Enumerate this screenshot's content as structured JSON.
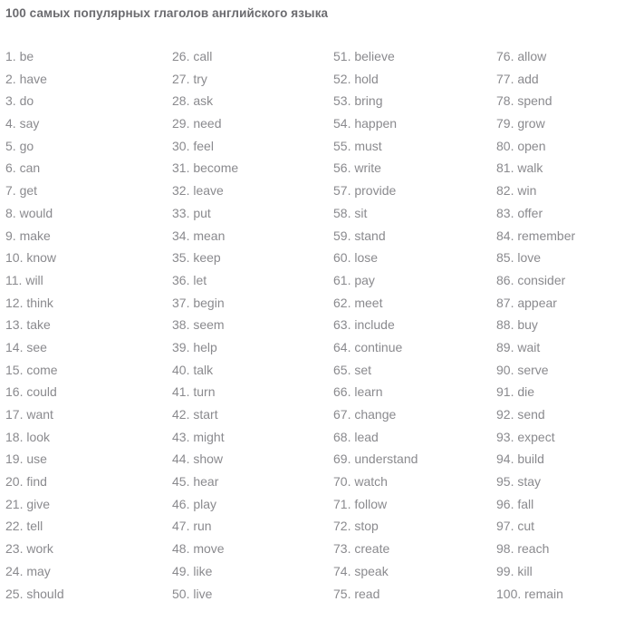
{
  "header": {
    "title": "100 самых популярных глаголов английского языка"
  },
  "colors": {
    "title_text": "#6b6b6f",
    "list_text": "#8a8a8e",
    "background": "#ffffff"
  },
  "columns": [
    {
      "name": "column-1",
      "items": [
        {
          "num": "1.",
          "word": "be"
        },
        {
          "num": "2.",
          "word": "have"
        },
        {
          "num": "3.",
          "word": "do"
        },
        {
          "num": "4.",
          "word": "say"
        },
        {
          "num": "5.",
          "word": "go"
        },
        {
          "num": "6.",
          "word": "can"
        },
        {
          "num": "7.",
          "word": "get"
        },
        {
          "num": "8.",
          "word": "would"
        },
        {
          "num": "9.",
          "word": "make"
        },
        {
          "num": "10.",
          "word": "know"
        },
        {
          "num": "11.",
          "word": "will"
        },
        {
          "num": "12.",
          "word": "think"
        },
        {
          "num": "13.",
          "word": "take"
        },
        {
          "num": "14.",
          "word": "see"
        },
        {
          "num": "15.",
          "word": "come"
        },
        {
          "num": "16.",
          "word": "could"
        },
        {
          "num": "17.",
          "word": "want"
        },
        {
          "num": "18.",
          "word": "look"
        },
        {
          "num": "19.",
          "word": "use"
        },
        {
          "num": "20.",
          "word": "find"
        },
        {
          "num": "21.",
          "word": "give"
        },
        {
          "num": "22.",
          "word": "tell"
        },
        {
          "num": "23.",
          "word": "work"
        },
        {
          "num": "24.",
          "word": "may"
        },
        {
          "num": "25.",
          "word": "should"
        }
      ]
    },
    {
      "name": "column-2",
      "items": [
        {
          "num": "26.",
          "word": "call"
        },
        {
          "num": "27.",
          "word": "try"
        },
        {
          "num": "28.",
          "word": "ask"
        },
        {
          "num": "29.",
          "word": "need"
        },
        {
          "num": "30.",
          "word": "feel"
        },
        {
          "num": "31.",
          "word": "become"
        },
        {
          "num": "32.",
          "word": "leave"
        },
        {
          "num": "33.",
          "word": "put"
        },
        {
          "num": "34.",
          "word": "mean"
        },
        {
          "num": "35.",
          "word": "keep"
        },
        {
          "num": "36.",
          "word": "let"
        },
        {
          "num": "37.",
          "word": "begin"
        },
        {
          "num": "38.",
          "word": "seem"
        },
        {
          "num": "39.",
          "word": "help"
        },
        {
          "num": "40.",
          "word": "talk"
        },
        {
          "num": "41.",
          "word": "turn"
        },
        {
          "num": "42.",
          "word": "start"
        },
        {
          "num": "43.",
          "word": "might"
        },
        {
          "num": "44.",
          "word": "show"
        },
        {
          "num": "45.",
          "word": "hear"
        },
        {
          "num": "46.",
          "word": "play"
        },
        {
          "num": "47.",
          "word": "run"
        },
        {
          "num": "48.",
          "word": "move"
        },
        {
          "num": "49.",
          "word": "like"
        },
        {
          "num": "50.",
          "word": "live"
        }
      ]
    },
    {
      "name": "column-3",
      "items": [
        {
          "num": "51.",
          "word": "believe"
        },
        {
          "num": "52.",
          "word": "hold"
        },
        {
          "num": "53.",
          "word": "bring"
        },
        {
          "num": "54.",
          "word": "happen"
        },
        {
          "num": "55.",
          "word": "must"
        },
        {
          "num": "56.",
          "word": "write"
        },
        {
          "num": "57.",
          "word": "provide"
        },
        {
          "num": "58.",
          "word": "sit"
        },
        {
          "num": "59.",
          "word": "stand"
        },
        {
          "num": "60.",
          "word": "lose"
        },
        {
          "num": "61.",
          "word": "pay"
        },
        {
          "num": "62.",
          "word": "meet"
        },
        {
          "num": "63.",
          "word": "include"
        },
        {
          "num": "64.",
          "word": "continue"
        },
        {
          "num": "65.",
          "word": "set"
        },
        {
          "num": "66.",
          "word": "learn"
        },
        {
          "num": "67.",
          "word": "change"
        },
        {
          "num": "68.",
          "word": "lead"
        },
        {
          "num": "69.",
          "word": "understand"
        },
        {
          "num": "70.",
          "word": "watch"
        },
        {
          "num": "71.",
          "word": "follow"
        },
        {
          "num": "72.",
          "word": "stop"
        },
        {
          "num": "73.",
          "word": "create"
        },
        {
          "num": "74.",
          "word": "speak"
        },
        {
          "num": "75.",
          "word": "read"
        }
      ]
    },
    {
      "name": "column-4",
      "items": [
        {
          "num": "76.",
          "word": "allow"
        },
        {
          "num": "77.",
          "word": "add"
        },
        {
          "num": "78.",
          "word": "spend"
        },
        {
          "num": "79.",
          "word": "grow"
        },
        {
          "num": "80.",
          "word": "open"
        },
        {
          "num": "81.",
          "word": "walk"
        },
        {
          "num": "82.",
          "word": "win"
        },
        {
          "num": "83.",
          "word": "offer"
        },
        {
          "num": "84.",
          "word": "remember"
        },
        {
          "num": "85.",
          "word": "love"
        },
        {
          "num": "86.",
          "word": "consider"
        },
        {
          "num": "87.",
          "word": "appear"
        },
        {
          "num": "88.",
          "word": "buy"
        },
        {
          "num": "89.",
          "word": "wait"
        },
        {
          "num": "90.",
          "word": "serve"
        },
        {
          "num": "91.",
          "word": "die"
        },
        {
          "num": "92.",
          "word": "send"
        },
        {
          "num": "93.",
          "word": "expect"
        },
        {
          "num": "94.",
          "word": "build"
        },
        {
          "num": "95.",
          "word": "stay"
        },
        {
          "num": "96.",
          "word": "fall"
        },
        {
          "num": "97.",
          "word": "cut"
        },
        {
          "num": "98.",
          "word": "reach"
        },
        {
          "num": "99.",
          "word": "kill"
        },
        {
          "num": "100.",
          "word": "remain"
        }
      ]
    }
  ]
}
